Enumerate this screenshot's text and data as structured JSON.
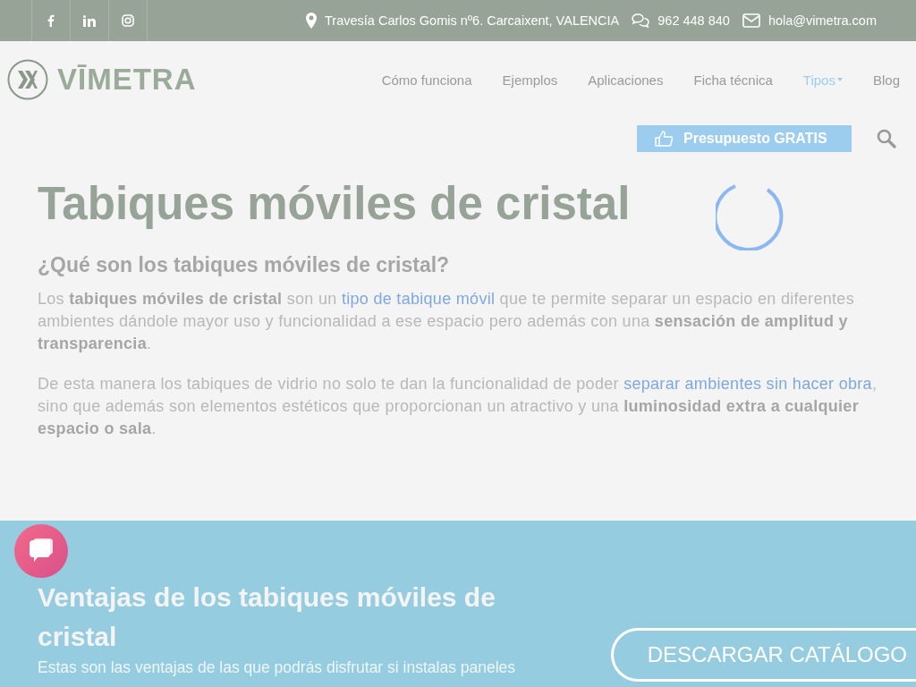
{
  "topbar": {
    "social": [
      {
        "kind": "facebook"
      },
      {
        "kind": "linkedin"
      },
      {
        "kind": "instagram"
      }
    ],
    "contacts": [
      {
        "kind": "pin",
        "text": "Travesía Carlos Gomis nº6. Carcaixent, VALENCIA"
      },
      {
        "kind": "chat",
        "text": "962 448 840"
      },
      {
        "kind": "mail",
        "text": "hola@vimetra.com"
      }
    ]
  },
  "header": {
    "logo": "VĪMETRA",
    "nav": [
      {
        "label": "Cómo funciona",
        "selected": false,
        "dropdown": false
      },
      {
        "label": "Ejemplos",
        "selected": false,
        "dropdown": false
      },
      {
        "label": "Aplicaciones",
        "selected": false,
        "dropdown": false
      },
      {
        "label": "Ficha técnica",
        "selected": false,
        "dropdown": false
      },
      {
        "label": "Tipos",
        "selected": true,
        "dropdown": true
      },
      {
        "label": "Blog",
        "selected": false,
        "dropdown": false
      }
    ],
    "cta": "Presupuesto GRATIS"
  },
  "main": {
    "title": "Tabiques móviles de cristal",
    "subtitle": "¿Qué son los tabiques móviles de cristal?",
    "paragraphs": [
      [
        {
          "kind": "text",
          "text": "Los "
        },
        {
          "kind": "bold",
          "text": "tabiques móviles de cristal"
        },
        {
          "kind": "text",
          "text": " son un "
        },
        {
          "kind": "link",
          "text": "tipo de tabique móvil"
        },
        {
          "kind": "text",
          "text": " que te permite separar un espacio en diferentes ambientes dándole mayor uso y funcionalidad a ese espacio pero además con una "
        },
        {
          "kind": "bold",
          "text": "sensación de amplitud y transparencia"
        },
        {
          "kind": "text",
          "text": "."
        }
      ],
      [
        {
          "kind": "text",
          "text": "De esta manera los tabiques de vidrio no solo te dan la funcionalidad de poder "
        },
        {
          "kind": "link",
          "text": "separar ambientes sin hacer obra"
        },
        {
          "kind": "text",
          "text": ", sino que además son elementos estéticos que proporcionan un atractivo y una "
        },
        {
          "kind": "bold",
          "text": "luminosidad extra a cualquier espacio o sala"
        },
        {
          "kind": "text",
          "text": "."
        }
      ]
    ]
  },
  "advantages": {
    "title": "Ventajas de los tabiques móviles de cristal",
    "text": "Estas son las ventajas de las que podrás disfrutar si instalas paneles",
    "button": "DESCARGAR CATÁLOGO"
  }
}
